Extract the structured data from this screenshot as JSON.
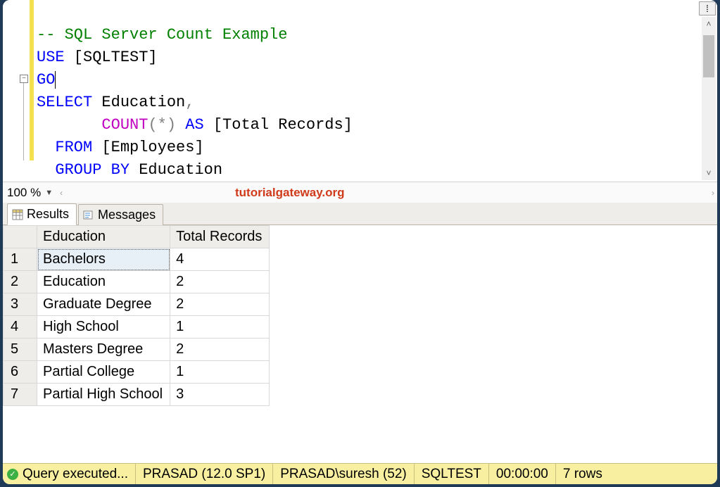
{
  "editor": {
    "line1_comment": "-- SQL Server Count Example",
    "line2_use": "USE",
    "line2_db": " [SQLTEST]",
    "line3_go": "GO",
    "line4_select": "SELECT",
    "line4_rest": " Education",
    "line4_comma": ",",
    "line5_indent": "       ",
    "line5_count": "COUNT",
    "line5_paren_open": "(",
    "line5_star": "*",
    "line5_paren_close": ")",
    "line5_as": " AS",
    "line5_alias": " [Total Records]",
    "line6_indent": "  ",
    "line6_from": "FROM",
    "line6_table": " [Employees]",
    "line7_indent": "  ",
    "line7_groupby": "GROUP BY",
    "line7_col": " Education"
  },
  "zoom": {
    "value": "100 %"
  },
  "watermark": "tutorialgateway.org",
  "tabs": {
    "results": "Results",
    "messages": "Messages"
  },
  "grid": {
    "columns": [
      "Education",
      "Total Records"
    ],
    "rows": [
      {
        "n": "1",
        "education": "Bachelors",
        "total": "4"
      },
      {
        "n": "2",
        "education": "Education",
        "total": "2"
      },
      {
        "n": "3",
        "education": "Graduate Degree",
        "total": "2"
      },
      {
        "n": "4",
        "education": "High School",
        "total": "1"
      },
      {
        "n": "5",
        "education": "Masters Degree",
        "total": "2"
      },
      {
        "n": "6",
        "education": "Partial College",
        "total": "1"
      },
      {
        "n": "7",
        "education": "Partial High School",
        "total": "3"
      }
    ]
  },
  "status": {
    "query": "Query executed...",
    "server": "PRASAD (12.0 SP1)",
    "user": "PRASAD\\suresh (52)",
    "db": "SQLTEST",
    "time": "00:00:00",
    "rows": "7 rows"
  }
}
